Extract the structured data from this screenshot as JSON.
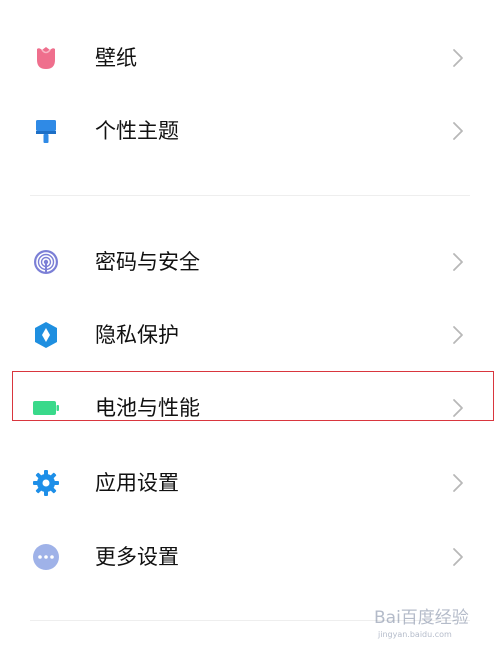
{
  "settings": {
    "items": [
      {
        "label": "壁纸",
        "icon": "wallpaper-tulip-icon"
      },
      {
        "label": "个性主题",
        "icon": "theme-brush-icon"
      },
      {
        "label": "密码与安全",
        "icon": "fingerprint-icon"
      },
      {
        "label": "隐私保护",
        "icon": "privacy-shield-icon"
      },
      {
        "label": "电池与性能",
        "icon": "battery-icon"
      },
      {
        "label": "应用设置",
        "icon": "app-settings-gear-icon"
      },
      {
        "label": "更多设置",
        "icon": "more-dots-icon"
      }
    ],
    "highlighted_item": "电池与性能"
  },
  "colors": {
    "wallpaper_icon": "#ef6f8d",
    "theme_icon": "#2f8ae6",
    "security_icon": "#7b7fd6",
    "privacy_icon": "#1f8fe0",
    "battery_icon": "#39d98a",
    "app_settings_icon": "#1e8fe8",
    "more_settings_icon": "#9fb2e8",
    "highlight_border": "#d9363e",
    "chevron": "#b8b8b8",
    "text": "#111111"
  },
  "watermark": {
    "text": "Bai百度经验",
    "subtext": "jingyan.baidu.com"
  }
}
